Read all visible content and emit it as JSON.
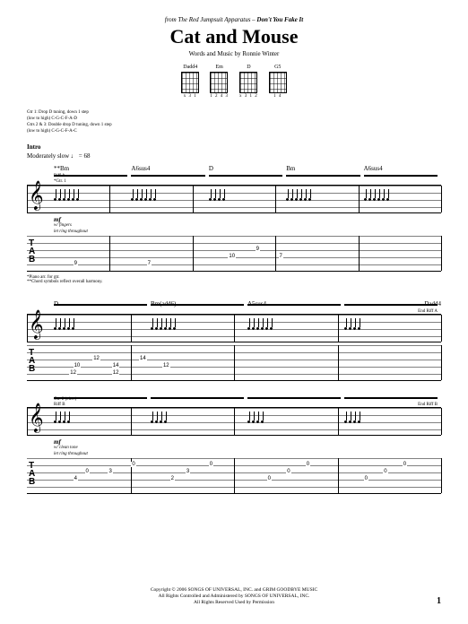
{
  "header": {
    "from_prefix": "from The Red Jumpsuit Apparatus –",
    "album": "Don't You Fake It",
    "title": "Cat and Mouse",
    "credits": "Words and Music by Ronnie Winter"
  },
  "chord_diagrams": [
    {
      "name": "Dadd4",
      "fingering": "x 3 1"
    },
    {
      "name": "Em",
      "fingering": "1 2 4 3"
    },
    {
      "name": "D",
      "fingering": "x 3 1 2"
    },
    {
      "name": "G5",
      "fingering": "1 4"
    }
  ],
  "tuning_notes": [
    "Gtr 1: Drop D tuning, down 1 step",
    "(low to high) C-G-C-F-A-D",
    "Gtrs 2 & 3: Double drop D tuning, down 1 step",
    "(low to high) C-G-C-F-A-C"
  ],
  "intro": {
    "label": "Intro",
    "tempo": "Moderately slow ♩ = 68",
    "riff_label": "Riff A",
    "dynamic": "mf",
    "perf_notes": [
      "w/ fingers",
      "let ring throughout"
    ],
    "footnote": "*Piano arr. for gtr.\n**Chord symbols reflect overall harmony."
  },
  "system1": {
    "chords": [
      "**Bm",
      "A6sus4",
      "D",
      "Bm",
      "A6sus4"
    ],
    "gtr_label": "*Gtr. 1",
    "tab_rows": [
      [
        {
          "t": 4,
          "l": "5%"
        },
        {
          "t": 12,
          "l": "8%"
        },
        {
          "t": 4,
          "l": "11%"
        },
        {
          "t": 12,
          "l": "14%"
        },
        {
          "t": 4,
          "l": "18%"
        },
        {
          "t": 12,
          "l": "21%"
        },
        {
          "t": 4,
          "l": "24%"
        },
        {
          "t": 12,
          "l": "27%"
        }
      ],
      [
        {
          "t": 20,
          "l": "45%",
          "v": "10"
        },
        {
          "t": 12,
          "l": "52%",
          "v": "9"
        },
        {
          "t": 20,
          "l": "58%",
          "v": "7"
        }
      ],
      [
        {
          "t": 28,
          "l": "5%",
          "v": "9"
        },
        {
          "t": 28,
          "l": "24%",
          "v": "7"
        }
      ]
    ]
  },
  "system2": {
    "chords": [
      "D",
      "Bm(add6)",
      "A5sus4",
      "Dadd4"
    ],
    "end_riff": "End Riff A",
    "tab_rows": [
      [
        {
          "t": 20,
          "l": "5%",
          "v": "10"
        },
        {
          "t": 12,
          "l": "10%",
          "v": "12"
        },
        {
          "t": 20,
          "l": "15%",
          "v": "14"
        },
        {
          "t": 12,
          "l": "22%",
          "v": "14"
        },
        {
          "t": 20,
          "l": "28%",
          "v": "12"
        }
      ],
      [
        {
          "t": 28,
          "l": "4%",
          "v": "12"
        },
        {
          "t": 28,
          "l": "15%",
          "v": "12"
        }
      ]
    ]
  },
  "system3": {
    "gtr_label": "Gtr. 2 (elec.)",
    "riff_label": "Riff B",
    "end_riff": "End Riff B",
    "dynamic": "mf",
    "perf_notes": [
      "w/ clean tone",
      "let ring throughout"
    ],
    "tab_rows": [
      [
        {
          "t": 12,
          "l": "8%",
          "v": "0"
        },
        {
          "t": 12,
          "l": "14%",
          "v": "3"
        },
        {
          "t": 4,
          "l": "20%",
          "v": "0"
        },
        {
          "t": 12,
          "l": "34%",
          "v": "3"
        },
        {
          "t": 4,
          "l": "40%",
          "v": "0"
        }
      ],
      [
        {
          "t": 20,
          "l": "5%",
          "v": "4"
        },
        {
          "t": 20,
          "l": "30%",
          "v": "2"
        },
        {
          "t": 20,
          "l": "55%",
          "v": "0"
        },
        {
          "t": 12,
          "l": "60%",
          "v": "0"
        },
        {
          "t": 4,
          "l": "65%",
          "v": "0"
        },
        {
          "t": 20,
          "l": "80%",
          "v": "0"
        },
        {
          "t": 12,
          "l": "85%",
          "v": "0"
        },
        {
          "t": 4,
          "l": "90%",
          "v": "0"
        }
      ]
    ]
  },
  "copyright": {
    "line1": "Copyright © 2006 SONGS OF UNIVERSAL, INC. and GRIM GOODBYE MUSIC",
    "line2": "All Rights Controlled and Administered by SONGS OF UNIVERSAL, INC.",
    "line3": "All Rights Reserved   Used by Permission"
  },
  "page_number": "1"
}
